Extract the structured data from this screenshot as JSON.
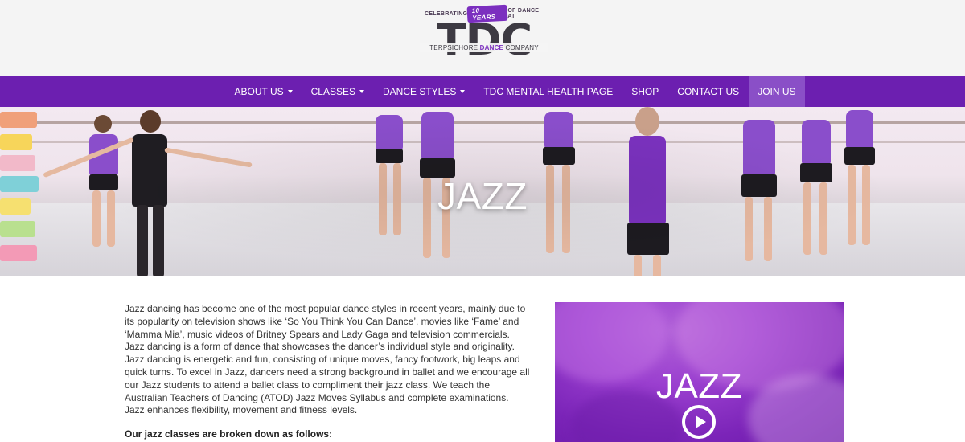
{
  "logo": {
    "tagline_left": "CELEBRATING",
    "years": "10 YEARS",
    "tagline_right": "OF DANCE AT",
    "letters": "TDC",
    "sub_prefix": "TERPSICHORE ",
    "sub_highlight": "DANCE",
    "sub_suffix": " COMPANY"
  },
  "nav": {
    "items": [
      {
        "label": "ABOUT US",
        "dropdown": true
      },
      {
        "label": "CLASSES",
        "dropdown": true
      },
      {
        "label": "DANCE STYLES",
        "dropdown": true
      },
      {
        "label": "TDC MENTAL HEALTH PAGE",
        "dropdown": false
      },
      {
        "label": "SHOP",
        "dropdown": false
      },
      {
        "label": "CONTACT US",
        "dropdown": false
      },
      {
        "label": "JOIN US",
        "dropdown": false,
        "active": true
      }
    ]
  },
  "hero": {
    "title": "JAZZ"
  },
  "content": {
    "paragraph": "Jazz dancing has become one of the most popular dance styles in recent years, mainly due to its popularity on television shows like ‘So You Think You Can Dance’, movies like ‘Fame’ and ‘Mamma Mia’, music videos of Britney Spears and Lady Gaga and television commercials. Jazz dancing is a form of dance that showcases the dancer’s individual style and originality. Jazz dancing is energetic and fun, consisting of unique moves, fancy footwork, big leaps and quick turns. To excel in Jazz, dancers need a strong background in ballet and we encourage all our Jazz students to attend a ballet class to compliment their jazz class. We teach the Australian Teachers of Dancing (ATOD) Jazz Moves Syllabus and complete examinations. Jazz enhances flexibility, movement and fitness levels.",
    "subheading": "Our jazz classes are broken down as follows:"
  },
  "video": {
    "title": "JAZZ",
    "icon": "play-circle-icon"
  },
  "colors": {
    "nav_bg": "#6c1fb0",
    "nav_active": "#8a4fc7",
    "header_bg": "#f4f4f4",
    "video_purple": "#8a30c4"
  }
}
